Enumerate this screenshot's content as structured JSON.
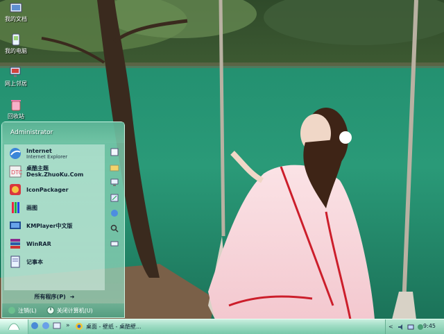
{
  "desktop": {
    "icons": [
      {
        "label": "我的文档",
        "icon": "my-documents-icon"
      },
      {
        "label": "我的电脑",
        "icon": "my-computer-icon"
      },
      {
        "label": "网上邻居",
        "icon": "network-places-icon"
      },
      {
        "label": "回收站",
        "icon": "recycle-bin-icon"
      }
    ]
  },
  "start_menu": {
    "user": "Administrator",
    "programs": [
      {
        "title": "Internet",
        "subtitle": "Internet Explorer",
        "icon": "internet-explorer-icon"
      },
      {
        "title": "桌酷主题Desk.ZhuoKu.Com",
        "subtitle": "",
        "icon": "zhuoku-icon"
      },
      {
        "title": "IconPackager",
        "subtitle": "",
        "icon": "iconpackager-icon"
      },
      {
        "title": "画图",
        "subtitle": "",
        "icon": "paint-icon"
      },
      {
        "title": "KMPlayer中文版",
        "subtitle": "",
        "icon": "kmplayer-icon"
      },
      {
        "title": "WinRAR",
        "subtitle": "",
        "icon": "winrar-icon"
      },
      {
        "title": "记事本",
        "subtitle": "",
        "icon": "notepad-icon"
      }
    ],
    "all_programs": "所有程序(P)",
    "right_icons": [
      "documents-icon",
      "folder-icon",
      "computer-icon",
      "control-panel-icon",
      "network-icon",
      "search-icon",
      "run-icon"
    ],
    "logoff": "注销(L)",
    "shutdown": "关闭计算机(U)"
  },
  "taskbar": {
    "task_label": "桌面 - 壁纸 - 桌酷壁...",
    "clock": "9:45"
  },
  "colors": {
    "accent": "#7cc8a9",
    "menu": "#8fd4b9"
  }
}
